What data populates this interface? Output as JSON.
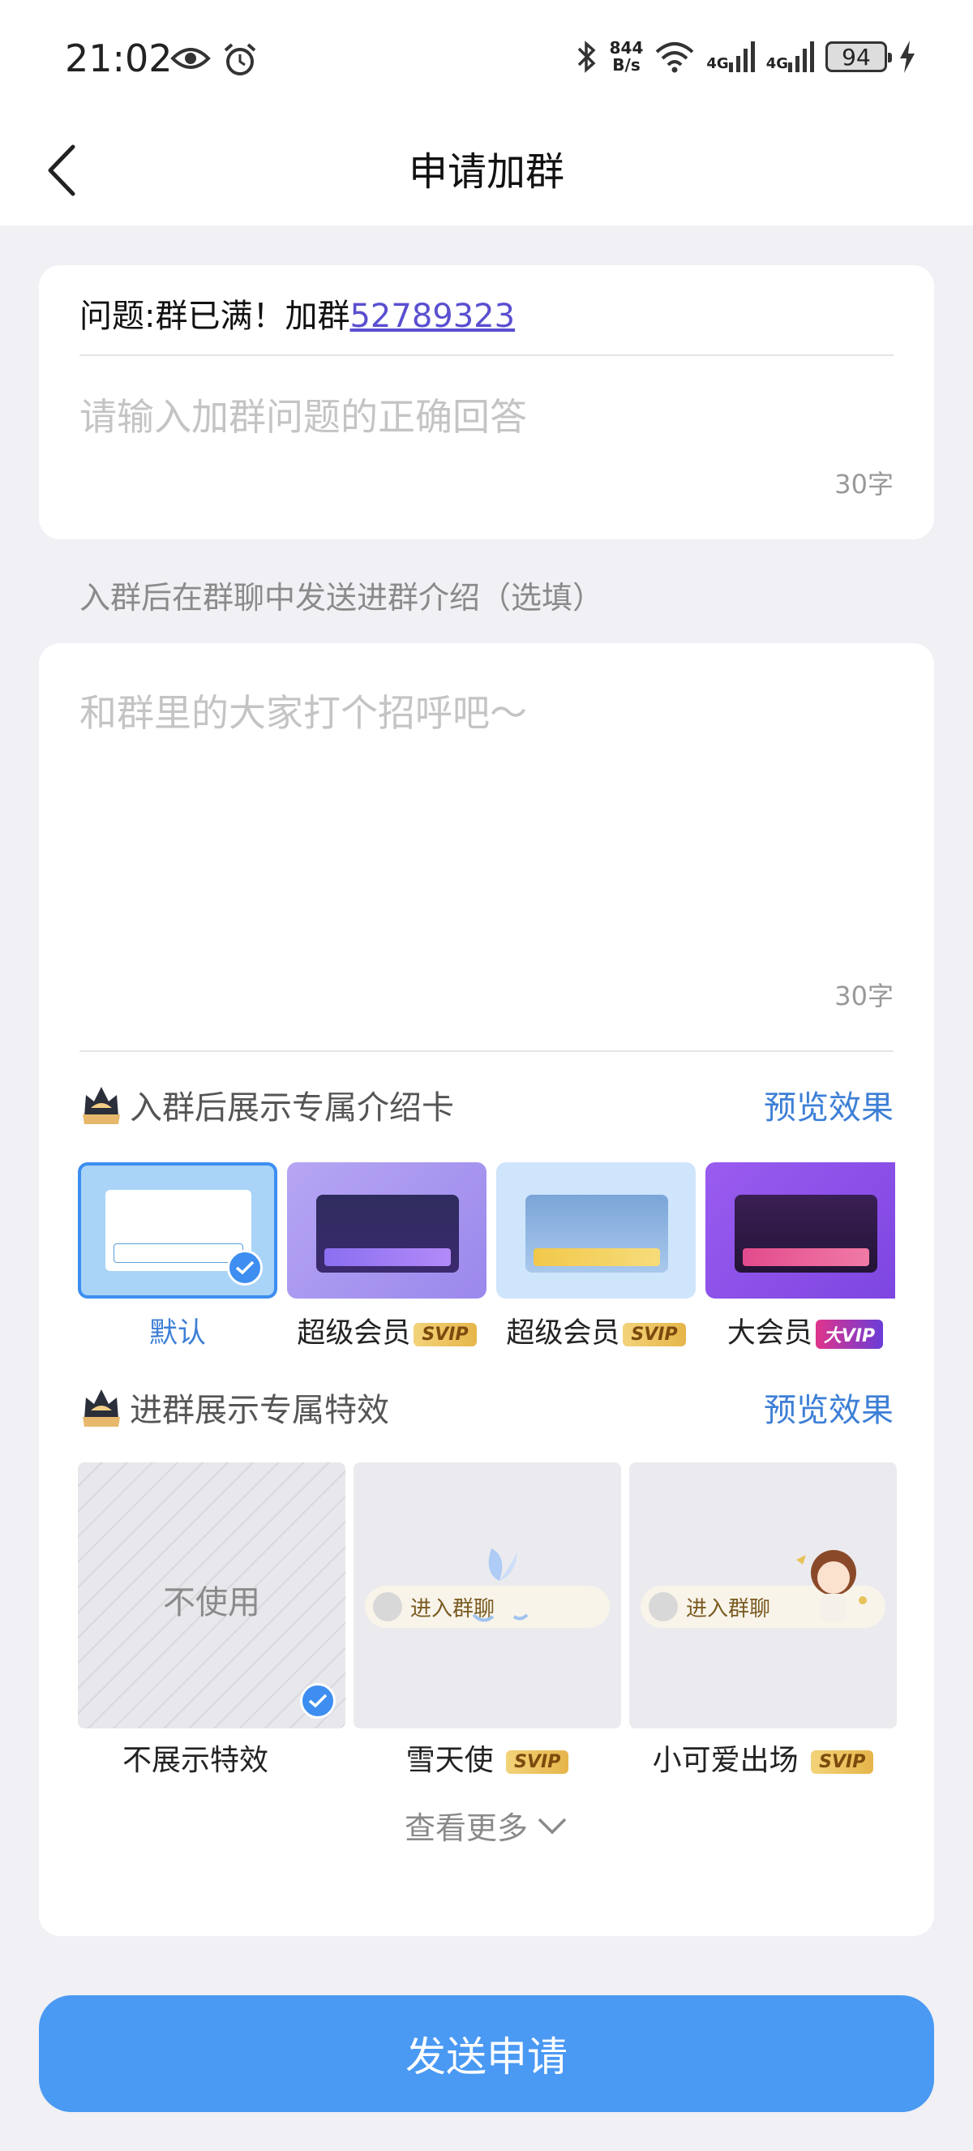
{
  "status": {
    "time": "21:02",
    "speed_top": "844",
    "speed_bottom": "B/s",
    "net1": "4G",
    "net2": "4G",
    "battery": "94"
  },
  "nav": {
    "title": "申请加群"
  },
  "question": {
    "label": "问题:群已满！加群",
    "link": "52789323",
    "answer_placeholder": "请输入加群问题的正确回答",
    "count": "30字"
  },
  "intro": {
    "section_label": "入群后在群聊中发送进群介绍（选填）",
    "placeholder": "和群里的大家打个招呼吧～",
    "count": "30字"
  },
  "intro_cards": {
    "title": "入群后展示专属介绍卡",
    "preview": "预览效果",
    "items": [
      {
        "label": "默认",
        "badge": "",
        "selected": true
      },
      {
        "label": "超级会员",
        "badge": "SVIP",
        "selected": false
      },
      {
        "label": "超级会员",
        "badge": "SVIP",
        "selected": false
      },
      {
        "label": "大会员",
        "badge": "大VIP",
        "selected": false
      }
    ]
  },
  "effects": {
    "title": "进群展示专属特效",
    "preview": "预览效果",
    "none_text": "不使用",
    "pill_text": "进入群聊",
    "items": [
      {
        "label": "不展示特效",
        "badge": "",
        "selected": true
      },
      {
        "label": "雪天使",
        "badge": "SVIP",
        "selected": false
      },
      {
        "label": "小可爱出场",
        "badge": "SVIP",
        "selected": false
      }
    ],
    "more": "查看更多"
  },
  "submit": {
    "label": "发送申请"
  },
  "colors": {
    "accent": "#4a99f3",
    "link": "#3d7fd6",
    "background": "#f0f0f5"
  }
}
